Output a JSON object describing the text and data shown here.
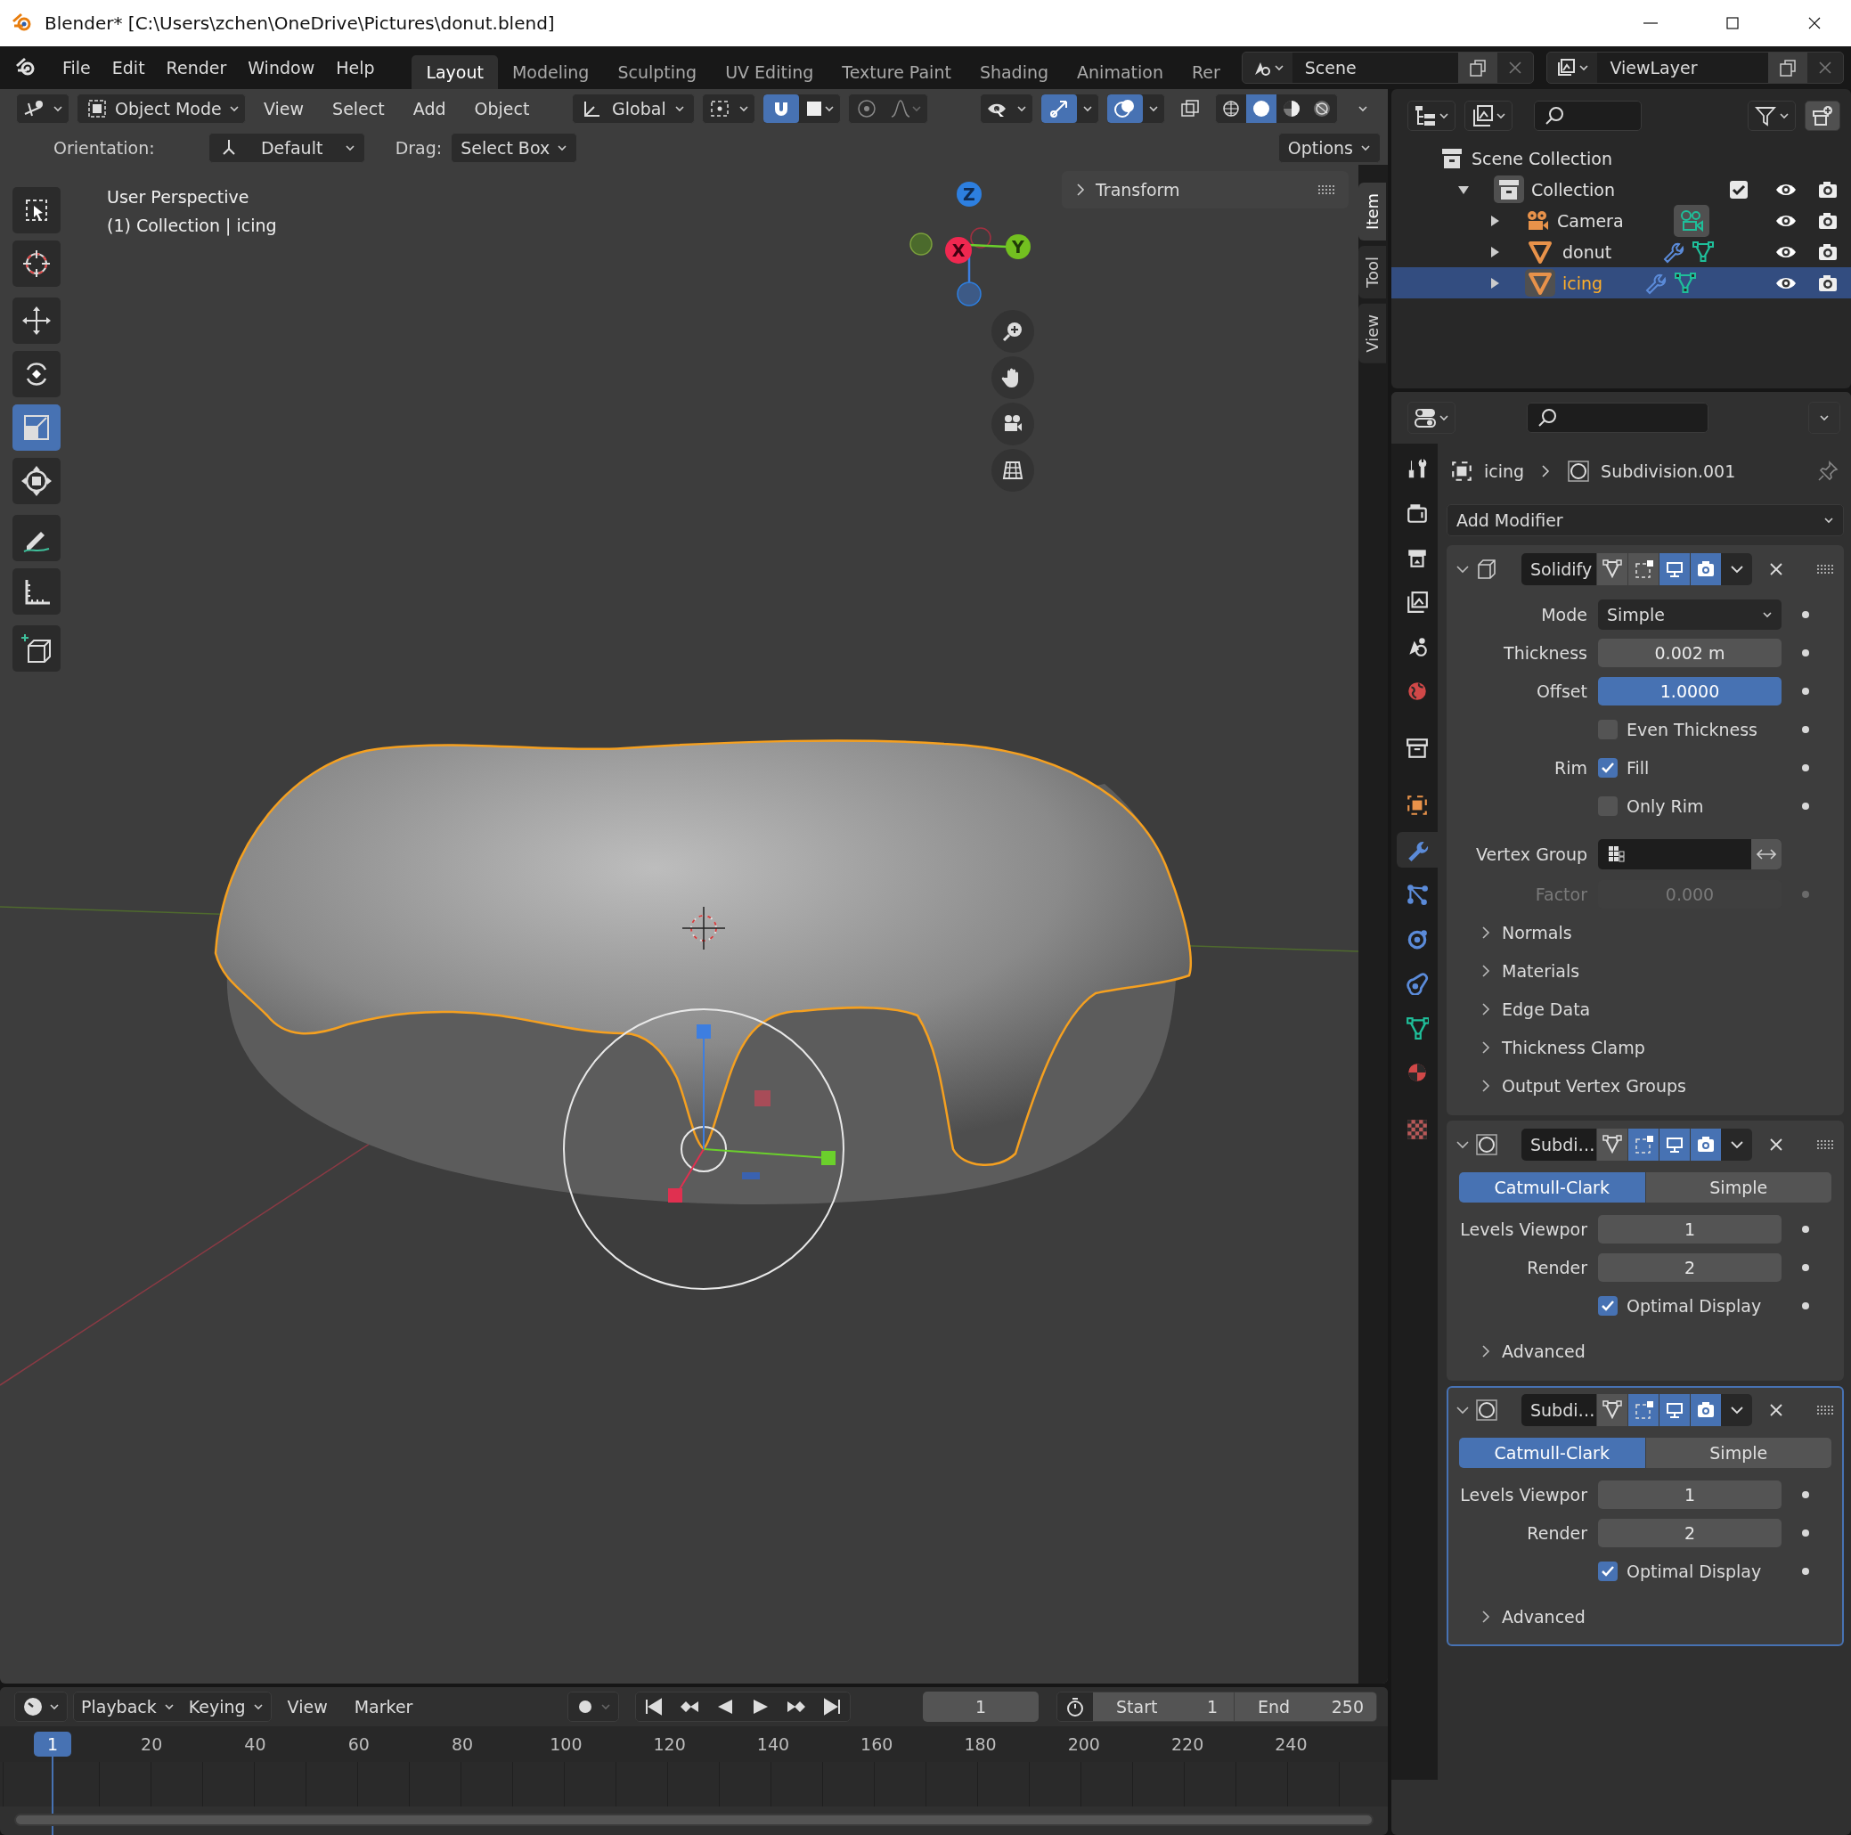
{
  "window": {
    "title": "Blender* [C:\\Users\\zchen\\OneDrive\\Pictures\\donut.blend]"
  },
  "menu_bar": {
    "menus": [
      "File",
      "Edit",
      "Render",
      "Window",
      "Help"
    ],
    "workspaces": [
      {
        "label": "Layout",
        "selected": true
      },
      {
        "label": "Modeling",
        "selected": false
      },
      {
        "label": "Sculpting",
        "selected": false
      },
      {
        "label": "UV Editing",
        "selected": false
      },
      {
        "label": "Texture Paint",
        "selected": false
      },
      {
        "label": "Shading",
        "selected": false
      },
      {
        "label": "Animation",
        "selected": false
      },
      {
        "label": "Rer",
        "selected": false
      }
    ],
    "scene": "Scene",
    "view_layer": "ViewLayer"
  },
  "viewport": {
    "header": {
      "mode": "Object Mode",
      "menus": [
        "View",
        "Select",
        "Add",
        "Object"
      ],
      "orientation": "Global",
      "snap": true,
      "proportional_editing": false,
      "gizmos": true,
      "overlays": true,
      "xray": false,
      "shading": [
        {
          "selected": false
        },
        {
          "selected": true
        },
        {
          "selected": false
        },
        {
          "selected": false
        }
      ]
    },
    "tool_settings": {
      "orientation_label": "Orientation:",
      "orientation": "Default",
      "drag_label": "Drag:",
      "drag": "Select Box",
      "options": "Options"
    },
    "info": [
      "User Perspective",
      "(1) Collection | icing"
    ],
    "tools": [
      {
        "selected": false
      },
      {
        "selected": false
      },
      {
        "selected": false
      },
      {
        "selected": false
      },
      {
        "selected": true
      },
      {
        "selected": false
      },
      {
        "selected": false
      },
      {
        "selected": false
      },
      {
        "selected": false
      }
    ],
    "axis_labels": [
      "Z",
      "X",
      "Y"
    ],
    "transform_panel": {
      "title": "Transform",
      "expanded": false
    },
    "side_tabs": [
      {
        "label": "Item",
        "selected": true
      },
      {
        "label": "Tool",
        "selected": false
      },
      {
        "label": "View",
        "selected": false
      }
    ]
  },
  "timeline": {
    "menus": [
      "Playback",
      "Keying",
      "View",
      "Marker"
    ],
    "current_frame": "1",
    "start_label": "Start",
    "start": "1",
    "end_label": "End",
    "end": "250",
    "playhead": "1",
    "ruler": [
      "20",
      "40",
      "60",
      "80",
      "100",
      "120",
      "140",
      "160",
      "180",
      "200",
      "220",
      "240"
    ]
  },
  "outliner": {
    "tree": [
      {
        "name": "Scene Collection",
        "kind": "scene_collection",
        "selected": false,
        "children": [
          {
            "name": "Collection",
            "kind": "collection",
            "selected": false,
            "expanded": true,
            "checked": true,
            "children": [
              {
                "name": "Camera",
                "kind": "camera",
                "selected": false,
                "expanded": false
              },
              {
                "name": "donut",
                "kind": "mesh",
                "selected": false,
                "expanded": false
              },
              {
                "name": "icing",
                "kind": "mesh",
                "selected": true,
                "expanded": false
              }
            ]
          }
        ]
      }
    ]
  },
  "properties": {
    "tabs": [
      {
        "selected": false
      },
      {
        "selected": false
      },
      {
        "selected": false
      },
      {
        "selected": false
      },
      {
        "selected": false
      },
      {
        "selected": false
      },
      {
        "selected": false
      },
      {
        "selected": false
      },
      {
        "selected": true
      },
      {
        "selected": false
      },
      {
        "selected": false
      },
      {
        "selected": false
      },
      {
        "selected": false
      },
      {
        "selected": false
      },
      {
        "selected": false
      }
    ],
    "breadcrumb": {
      "object": "icing",
      "modifier": "Subdivision.001"
    },
    "add_modifier": "Add Modifier",
    "modifiers": [
      {
        "kind": "solidify",
        "name": "Solidify",
        "expanded": true,
        "active": false,
        "toggles": [
          {
            "on": false
          },
          {
            "on": false
          },
          {
            "on": true
          },
          {
            "on": true
          }
        ],
        "rows": [
          {
            "kind": "dropdown",
            "label": "Mode",
            "value": "Simple"
          },
          {
            "kind": "number",
            "label": "Thickness",
            "value": "0.002 m",
            "highlighted": false,
            "disabled": false
          },
          {
            "kind": "number",
            "label": "Offset",
            "value": "1.0000",
            "highlighted": true,
            "disabled": false
          },
          {
            "kind": "checkbox",
            "text": "Even Thickness",
            "checked": false
          },
          {
            "kind": "checkbox",
            "label": "Rim",
            "text": "Fill",
            "checked": true
          },
          {
            "kind": "checkbox",
            "text": "Only Rim",
            "checked": false
          },
          {
            "kind": "vertex_group",
            "label": "Vertex Group"
          },
          {
            "kind": "number",
            "label": "Factor",
            "value": "0.000",
            "highlighted": false,
            "disabled": true
          }
        ],
        "subpanels": [
          {
            "label": "Normals",
            "expanded": false
          },
          {
            "label": "Materials",
            "expanded": false
          },
          {
            "label": "Edge Data",
            "expanded": false
          },
          {
            "label": "Thickness Clamp",
            "expanded": false
          },
          {
            "label": "Output Vertex Groups",
            "expanded": false
          }
        ]
      },
      {
        "kind": "subdivision",
        "name": "Subdi…",
        "expanded": true,
        "active": false,
        "toggles": [
          {
            "on": false
          },
          {
            "on": true
          },
          {
            "on": true
          },
          {
            "on": true
          }
        ],
        "methods": [
          {
            "label": "Catmull-Clark",
            "selected": true
          },
          {
            "label": "Simple",
            "selected": false
          }
        ],
        "rows": [
          {
            "kind": "number",
            "label": "Levels Viewpor",
            "value": "1",
            "highlighted": false,
            "disabled": false
          },
          {
            "kind": "number",
            "label": "Render",
            "value": "2",
            "highlighted": false,
            "disabled": false
          },
          {
            "kind": "checkbox",
            "text": "Optimal Display",
            "checked": true
          }
        ],
        "subpanels": [
          {
            "label": "Advanced",
            "expanded": false
          }
        ]
      },
      {
        "kind": "subdivision",
        "name": "Subdi…",
        "expanded": true,
        "active": true,
        "toggles": [
          {
            "on": false
          },
          {
            "on": true
          },
          {
            "on": true
          },
          {
            "on": true
          }
        ],
        "methods": [
          {
            "label": "Catmull-Clark",
            "selected": true
          },
          {
            "label": "Simple",
            "selected": false
          }
        ],
        "rows": [
          {
            "kind": "number",
            "label": "Levels Viewpor",
            "value": "1",
            "highlighted": false,
            "disabled": false
          },
          {
            "kind": "number",
            "label": "Render",
            "value": "2",
            "highlighted": false,
            "disabled": false
          },
          {
            "kind": "checkbox",
            "text": "Optimal Display",
            "checked": true
          }
        ],
        "subpanels": [
          {
            "label": "Advanced",
            "expanded": false
          }
        ]
      }
    ]
  }
}
